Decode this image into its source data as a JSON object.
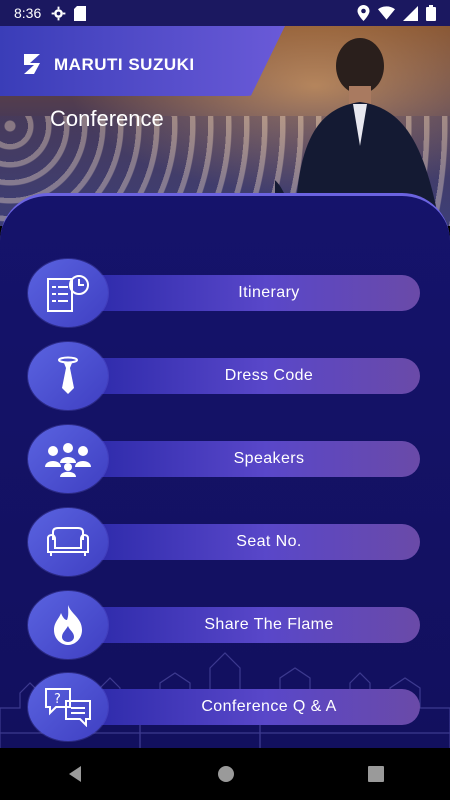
{
  "status_bar": {
    "time": "8:36"
  },
  "header": {
    "brand_name": "MARUTI SUZUKI",
    "title": "Conference"
  },
  "menu": [
    {
      "label": "Itinerary",
      "icon": "itinerary-icon"
    },
    {
      "label": "Dress Code",
      "icon": "tie-icon"
    },
    {
      "label": "Speakers",
      "icon": "group-icon"
    },
    {
      "label": "Seat No.",
      "icon": "sofa-icon"
    },
    {
      "label": "Share The Flame",
      "icon": "flame-icon"
    },
    {
      "label": "Conference Q & A",
      "icon": "chat-question-icon"
    }
  ],
  "colors": {
    "panel_bg": "#15136b",
    "bar_start": "#2a28a8",
    "bar_end": "#6a4aa8",
    "icon_bg": "#5a63e0"
  }
}
